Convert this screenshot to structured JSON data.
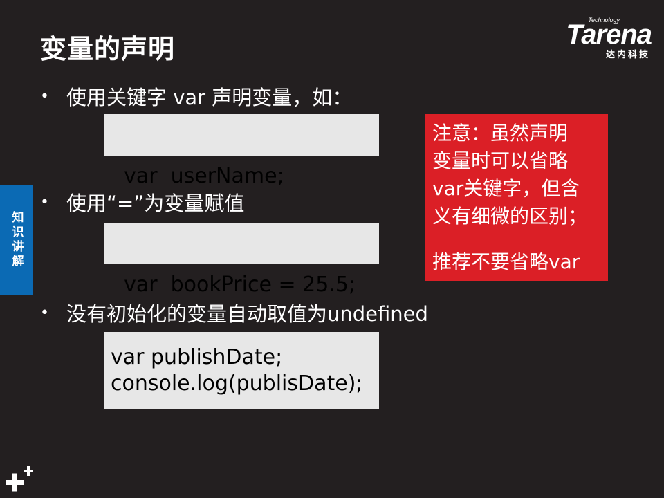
{
  "slide": {
    "title": "变量的声明",
    "logo": {
      "brand": "Tarena",
      "tagline": "Technology",
      "cn_name": "达内科技"
    },
    "side_tab_label": "知识讲解",
    "bullets": [
      {
        "text": "使用关键字 var 声明变量，如：",
        "code": [
          "var  userName;"
        ]
      },
      {
        "text": "使用“=”为变量赋值",
        "code": [
          "var  bookPrice = 25.5;"
        ]
      },
      {
        "text": "没有初始化的变量自动取值为undefined",
        "code": [
          "var publishDate;",
          "console.log(publisDate);"
        ]
      }
    ],
    "note": {
      "lines": [
        "注意：虽然声明",
        "变量时可以省略",
        "var关键字，但含",
        "义有细微的区别；"
      ],
      "recommendation": "推荐不要省略var"
    },
    "colors": {
      "background": "#231f20",
      "code_box": "#e7e7e7",
      "note_box": "#db1f26",
      "side_tab": "#0b6ab4"
    },
    "icons": [
      "plus-icon"
    ]
  }
}
